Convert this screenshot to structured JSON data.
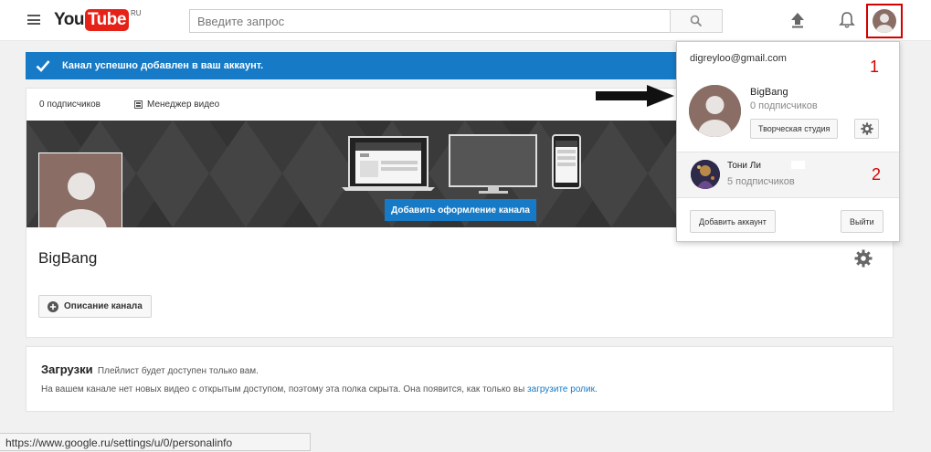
{
  "header": {
    "logo_you": "You",
    "logo_tube": "Tube",
    "logo_region": "RU",
    "search_placeholder": "Введите запрос"
  },
  "notification": {
    "text": "Канал успешно добавлен в ваш аккаунт.",
    "color": "#167ac6"
  },
  "channel": {
    "subscribers": "0 подписчиков",
    "video_manager": "Менеджер видео",
    "add_art_button": "Добавить оформление канала",
    "name": "BigBang",
    "description_button": "Описание канала"
  },
  "uploads": {
    "title": "Загрузки",
    "note": "Плейлист будет доступен только вам.",
    "text_before_link": "На вашем канале нет новых видео с открытым доступом, поэтому эта полка скрыта. Она появится, как только вы ",
    "link": "загрузите ролик",
    "text_after_link": "."
  },
  "status_bar": {
    "url": "https://www.google.ru/settings/u/0/personalinfo"
  },
  "account_menu": {
    "email": "digreyloo@gmail.com",
    "marker_1": "1",
    "marker_2": "2",
    "active_account": {
      "name": "BigBang",
      "subscribers": "0 подписчиков",
      "studio_button": "Творческая студия"
    },
    "other_account": {
      "name": "Тони Ли",
      "subscribers": "5 подписчиков"
    },
    "add_account_button": "Добавить аккаунт",
    "logout_button": "Выйти"
  },
  "colors": {
    "accent_blue": "#167ac6",
    "youtube_red": "#e62117",
    "annotation_red": "#d50000"
  }
}
